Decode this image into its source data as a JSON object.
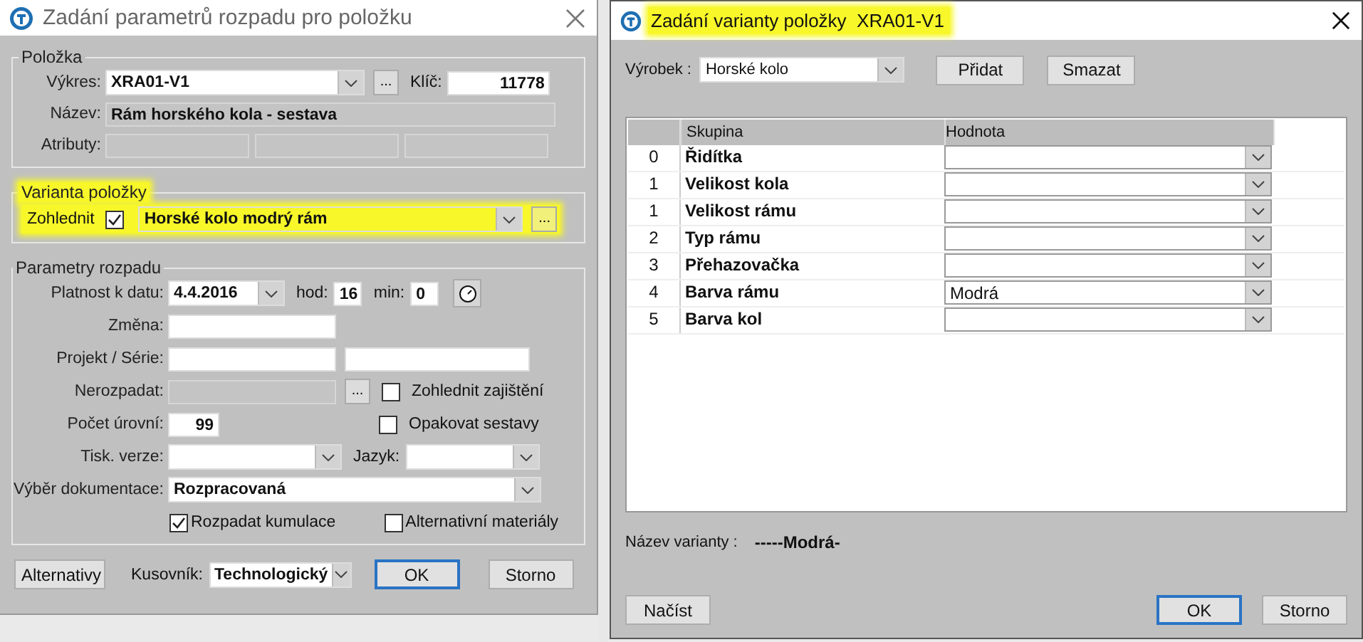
{
  "left_dialog": {
    "title": "Zadání parametrů rozpadu pro položku",
    "item_group": {
      "legend": "Položka",
      "drawing_label": "Výkres:",
      "drawing_value": "XRA01-V1",
      "key_label": "Klíč:",
      "key_value": "11778",
      "name_label": "Název:",
      "name_value": "Rám horského kola - sestava",
      "attributes_label": "Atributy:",
      "browse": "..."
    },
    "variant_group": {
      "legend": "Varianta položky",
      "highlighted": true,
      "consider_label": "Zohlednit",
      "consider_checked": true,
      "value": "Horské kolo modrý rám",
      "browse": "..."
    },
    "params_group": {
      "legend": "Parametry rozpadu",
      "date_label": "Platnost k datu:",
      "date_value": "4.4.2016",
      "hour_label": "hod:",
      "hour_value": "16",
      "min_label": "min:",
      "min_value": "0",
      "change_label": "Změna:",
      "project_label": "Projekt / Série:",
      "exclude_label": "Nerozpadat:",
      "browse": "...",
      "side_checks": [
        {
          "label": "Zohlednit zajištění",
          "checked": false
        },
        {
          "label": "Opakovat sestavy",
          "checked": false
        }
      ],
      "levels_label": "Počet úrovní:",
      "levels_value": "99",
      "print_label": "Tisk. verze:",
      "lang_label": "Jazyk:",
      "doc_label": "Výběr dokumentace:",
      "doc_value": "Rozpracovaná",
      "bottom_checks": [
        {
          "label": "Rozpadat kumulace",
          "checked": true
        },
        {
          "label": "Alternativní materiály",
          "checked": false
        }
      ]
    },
    "footer": {
      "alternatives": "Alternativy",
      "bom_label": "Kusovník:",
      "bom_value": "Technologický",
      "ok": "OK",
      "cancel": "Storno"
    }
  },
  "right_dialog": {
    "title": "Zadání varianty položky  XRA01-V1",
    "title_highlighted": true,
    "product_label": "Výrobek :",
    "product_value": "Horské kolo",
    "buttons": [
      "Přidat",
      "Smazat"
    ],
    "table": {
      "columns": [
        "Skupina",
        "Hodnota"
      ],
      "rows": [
        {
          "index": "0",
          "group": "Řidítka",
          "value": ""
        },
        {
          "index": "1",
          "group": "Velikost kola",
          "value": ""
        },
        {
          "index": "1",
          "group": "Velikost rámu",
          "value": ""
        },
        {
          "index": "2",
          "group": "Typ rámu",
          "value": ""
        },
        {
          "index": "3",
          "group": "Přehazovačka",
          "value": ""
        },
        {
          "index": "4",
          "group": "Barva rámu",
          "value": "Modrá"
        },
        {
          "index": "5",
          "group": "Barva kol",
          "value": ""
        }
      ]
    },
    "variant_name_label": "Název varianty :",
    "variant_name": "-----Modrá-",
    "load": "Načíst",
    "ok": "OK",
    "cancel": "Storno"
  }
}
